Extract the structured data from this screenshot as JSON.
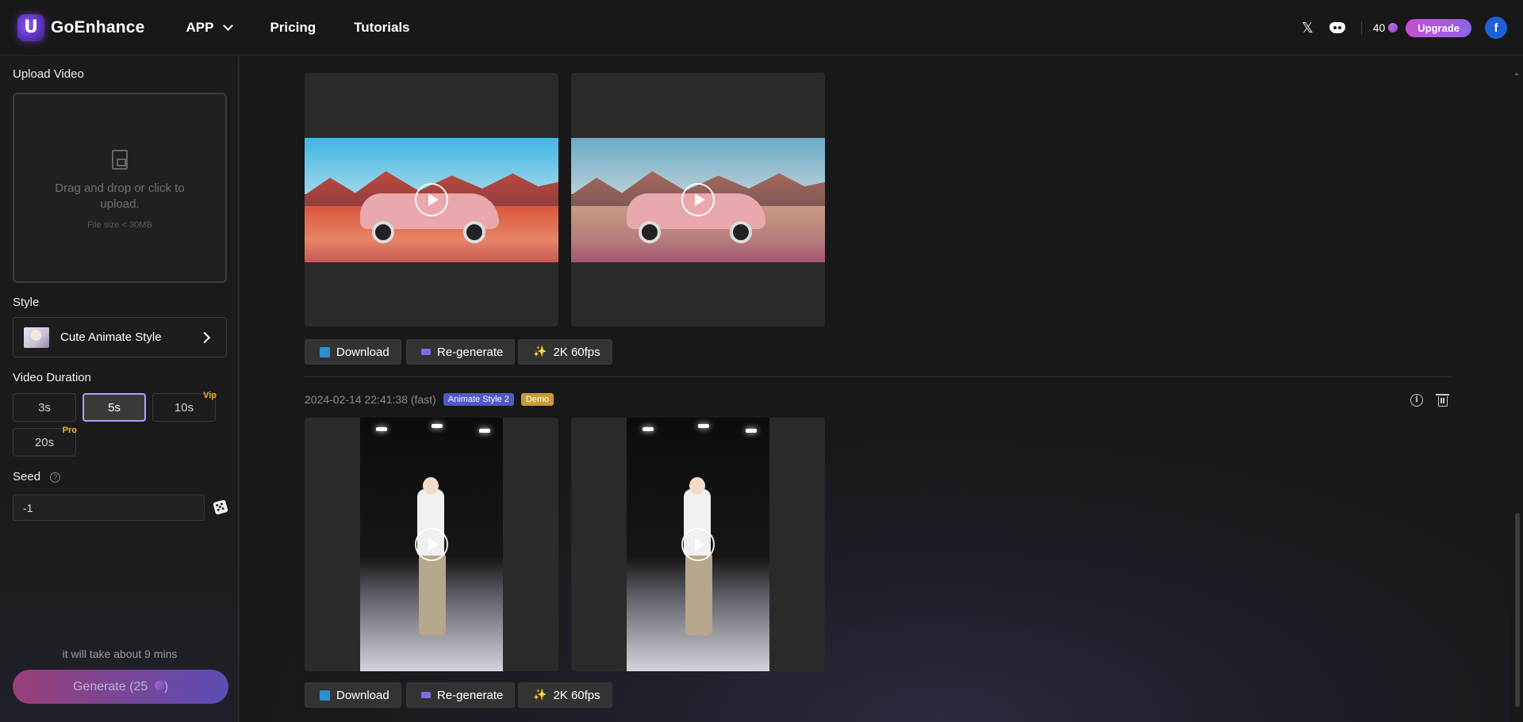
{
  "header": {
    "logo_text": "GoEnhance",
    "nav": [
      {
        "label": "APP",
        "has_dropdown": true
      },
      {
        "label": "Pricing"
      },
      {
        "label": "Tutorials"
      }
    ],
    "credits": "40",
    "upgrade_label": "Upgrade",
    "avatar_letter": "f"
  },
  "sidebar": {
    "upload_label": "Upload Video",
    "upload_text": "Drag and drop or click to upload.",
    "upload_sub": "File size < 30MB",
    "style_label": "Style",
    "style_value": "Cute Animate Style",
    "duration_label": "Video Duration",
    "durations": [
      {
        "label": "3s"
      },
      {
        "label": "5s",
        "active": true
      },
      {
        "label": "10s",
        "tag": "Vip"
      },
      {
        "label": "20s",
        "tag": "Pro"
      }
    ],
    "seed_label": "Seed",
    "seed_value": "-1",
    "time_note": "it will take about 9 mins",
    "generate_label": "Generate (25"
  },
  "results": [
    {
      "actions": {
        "download": "Download",
        "regenerate": "Re-generate",
        "upscale": "2K 60fps"
      }
    },
    {
      "timestamp": "2024-02-14 22:41:38 (fast)",
      "style_badge": "Animate Style 2",
      "demo_badge": "Demo",
      "actions": {
        "download": "Download",
        "regenerate": "Re-generate",
        "upscale": "2K 60fps"
      }
    }
  ],
  "colors": {
    "accent": "#b39cff",
    "upgrade": "#c84fd2",
    "vip_tag": "#f0b429",
    "style_badge": "#4e5ac8",
    "demo_badge": "#c99a35"
  }
}
